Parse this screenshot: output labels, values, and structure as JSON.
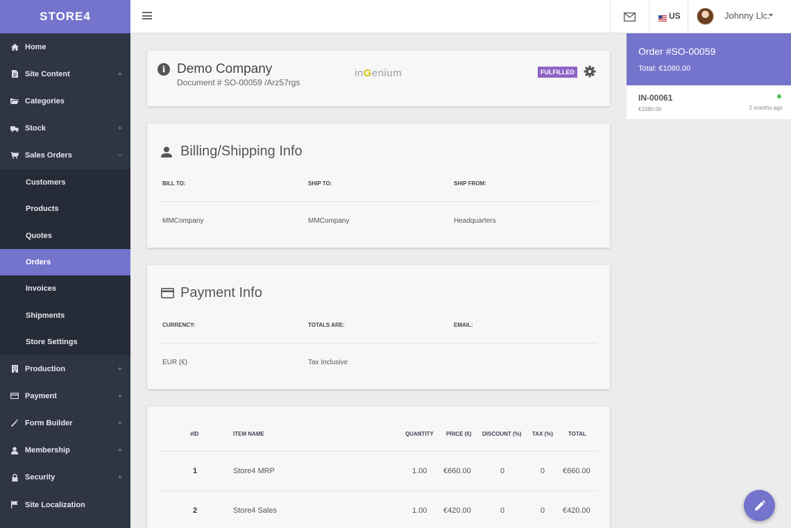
{
  "brand": "STORE4",
  "topbar": {
    "language": "US",
    "user_name": "Johnny Llc."
  },
  "sidebar": {
    "items": [
      {
        "label": "Home",
        "icon": "home-icon",
        "expander": ""
      },
      {
        "label": "Site Content",
        "icon": "file-icon",
        "expander": "+"
      },
      {
        "label": "Categories",
        "icon": "folder-icon",
        "expander": ""
      },
      {
        "label": "Stock",
        "icon": "truck-icon",
        "expander": "+"
      },
      {
        "label": "Sales Orders",
        "icon": "cart-icon",
        "expander": "−"
      }
    ],
    "sub_items": [
      {
        "label": "Customers"
      },
      {
        "label": "Products"
      },
      {
        "label": "Quotes"
      },
      {
        "label": "Orders",
        "active": true
      },
      {
        "label": "Invoices"
      },
      {
        "label": "Shipments"
      },
      {
        "label": "Store Settings"
      }
    ],
    "items_after": [
      {
        "label": "Production",
        "icon": "building-icon",
        "expander": "+"
      },
      {
        "label": "Payment",
        "icon": "credit-card-icon",
        "expander": "+"
      },
      {
        "label": "Form Builder",
        "icon": "magic-wand-icon",
        "expander": "+"
      },
      {
        "label": "Membership",
        "icon": "user-icon",
        "expander": "+"
      },
      {
        "label": "Security",
        "icon": "lock-icon",
        "expander": "+"
      },
      {
        "label": "Site Localization",
        "icon": "flag-icon",
        "expander": ""
      }
    ]
  },
  "document": {
    "company": "Demo Company",
    "document_number": "Document # SO-00059 /Arz57rgs",
    "logo_prefix": "in",
    "logo_highlight": "G",
    "logo_suffix": "enium",
    "status": "FULFILLED"
  },
  "billing": {
    "title": "Billing/Shipping Info",
    "labels": [
      "BILL TO:",
      "SHIP TO:",
      "SHIP FROM:"
    ],
    "values": [
      "MMCompany",
      "MMCompany",
      "Headquarters"
    ]
  },
  "payment": {
    "title": "Payment Info",
    "labels": [
      "CURRENCY:",
      "TOTALS ARE:",
      "EMAIL:"
    ],
    "values": [
      "EUR (€)",
      "Tax Inclusive",
      ""
    ]
  },
  "items_table": {
    "headers": [
      "#ID",
      "ITEM NAME",
      "QUANTITY",
      "PRICE (€)",
      "DISCOUNT (%)",
      "TAX (%)",
      "TOTAL"
    ],
    "rows": [
      [
        "1",
        "Store4 MRP",
        "1.00",
        "€660.00",
        "0",
        "0",
        "€660.00"
      ],
      [
        "2",
        "Store4 Sales",
        "1.00",
        "€420.00",
        "0",
        "0",
        "€420.00"
      ]
    ]
  },
  "order_panel": {
    "title": "Order #SO-00059",
    "total": "Total: €1080.00",
    "invoice": {
      "number": "IN-00061",
      "amount": "€1080.00",
      "time": "2 months ago",
      "status_color": "#4cc05a"
    }
  },
  "colors": {
    "accent": "#7474cc",
    "sidebar": "#2f3545",
    "badge": "#8f63c6"
  }
}
